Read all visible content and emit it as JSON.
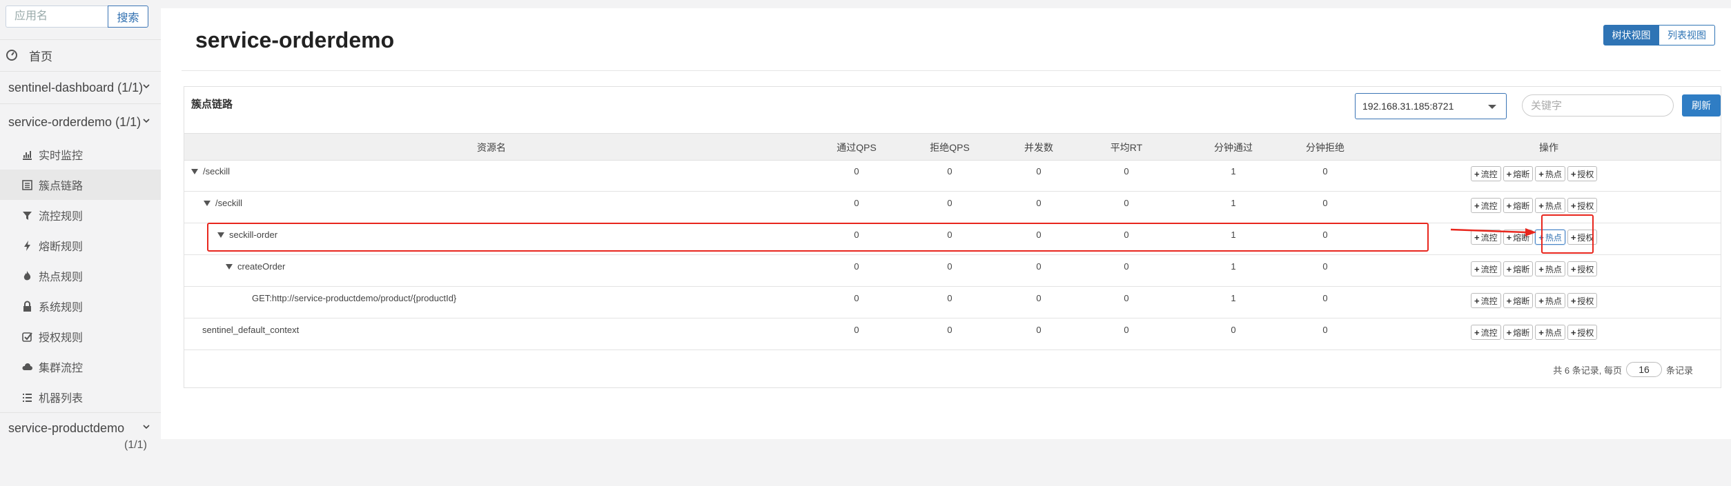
{
  "sidebar": {
    "search_placeholder": "应用名",
    "search_button": "搜索",
    "home_label": "首页",
    "apps": [
      {
        "name": "sentinel-dashboard",
        "count": "(1/1)"
      },
      {
        "name": "service-orderdemo",
        "count": "(1/1)"
      },
      {
        "name": "service-productdemo",
        "count": "(1/1)"
      }
    ],
    "menu": [
      {
        "label": "实时监控",
        "icon": "bar-chart-icon"
      },
      {
        "label": "簇点链路",
        "icon": "list-icon"
      },
      {
        "label": "流控规则",
        "icon": "filter-icon"
      },
      {
        "label": "熔断规则",
        "icon": "bolt-icon"
      },
      {
        "label": "热点规则",
        "icon": "fire-icon"
      },
      {
        "label": "系统规则",
        "icon": "lock-icon"
      },
      {
        "label": "授权规则",
        "icon": "check-icon"
      },
      {
        "label": "集群流控",
        "icon": "cloud-icon"
      },
      {
        "label": "机器列表",
        "icon": "table-list-icon"
      }
    ]
  },
  "main": {
    "title": "service-orderdemo",
    "view_tree": "树状视图",
    "view_list": "列表视图",
    "panel_title": "簇点链路",
    "machine": "192.168.31.185:8721",
    "keyword_placeholder": "关键字",
    "refresh": "刷新",
    "columns": [
      "资源名",
      "通过QPS",
      "拒绝QPS",
      "并发数",
      "平均RT",
      "分钟通过",
      "分钟拒绝",
      "操作"
    ],
    "rows": [
      {
        "name": "/seckill",
        "pass_qps": "0",
        "block_qps": "0",
        "threads": "0",
        "rt": "0",
        "min_pass": "1",
        "min_block": "0"
      },
      {
        "name": "/seckill",
        "pass_qps": "0",
        "block_qps": "0",
        "threads": "0",
        "rt": "0",
        "min_pass": "1",
        "min_block": "0"
      },
      {
        "name": "seckill-order",
        "pass_qps": "0",
        "block_qps": "0",
        "threads": "0",
        "rt": "0",
        "min_pass": "1",
        "min_block": "0"
      },
      {
        "name": "createOrder",
        "pass_qps": "0",
        "block_qps": "0",
        "threads": "0",
        "rt": "0",
        "min_pass": "1",
        "min_block": "0"
      },
      {
        "name": "GET:http://service-productdemo/product/{productId}",
        "pass_qps": "0",
        "block_qps": "0",
        "threads": "0",
        "rt": "0",
        "min_pass": "1",
        "min_block": "0"
      },
      {
        "name": "sentinel_default_context",
        "pass_qps": "0",
        "block_qps": "0",
        "threads": "0",
        "rt": "0",
        "min_pass": "0",
        "min_block": "0"
      }
    ],
    "op_labels": {
      "flow": "流控",
      "degrade": "熔断",
      "hot": "热点",
      "auth": "授权"
    },
    "pager": {
      "prefix": "共 6 条记录, 每页",
      "page_size": "16",
      "suffix": "条记录"
    }
  },
  "colors": {
    "accent": "#2f74b5",
    "annotation": "#e8261d"
  }
}
